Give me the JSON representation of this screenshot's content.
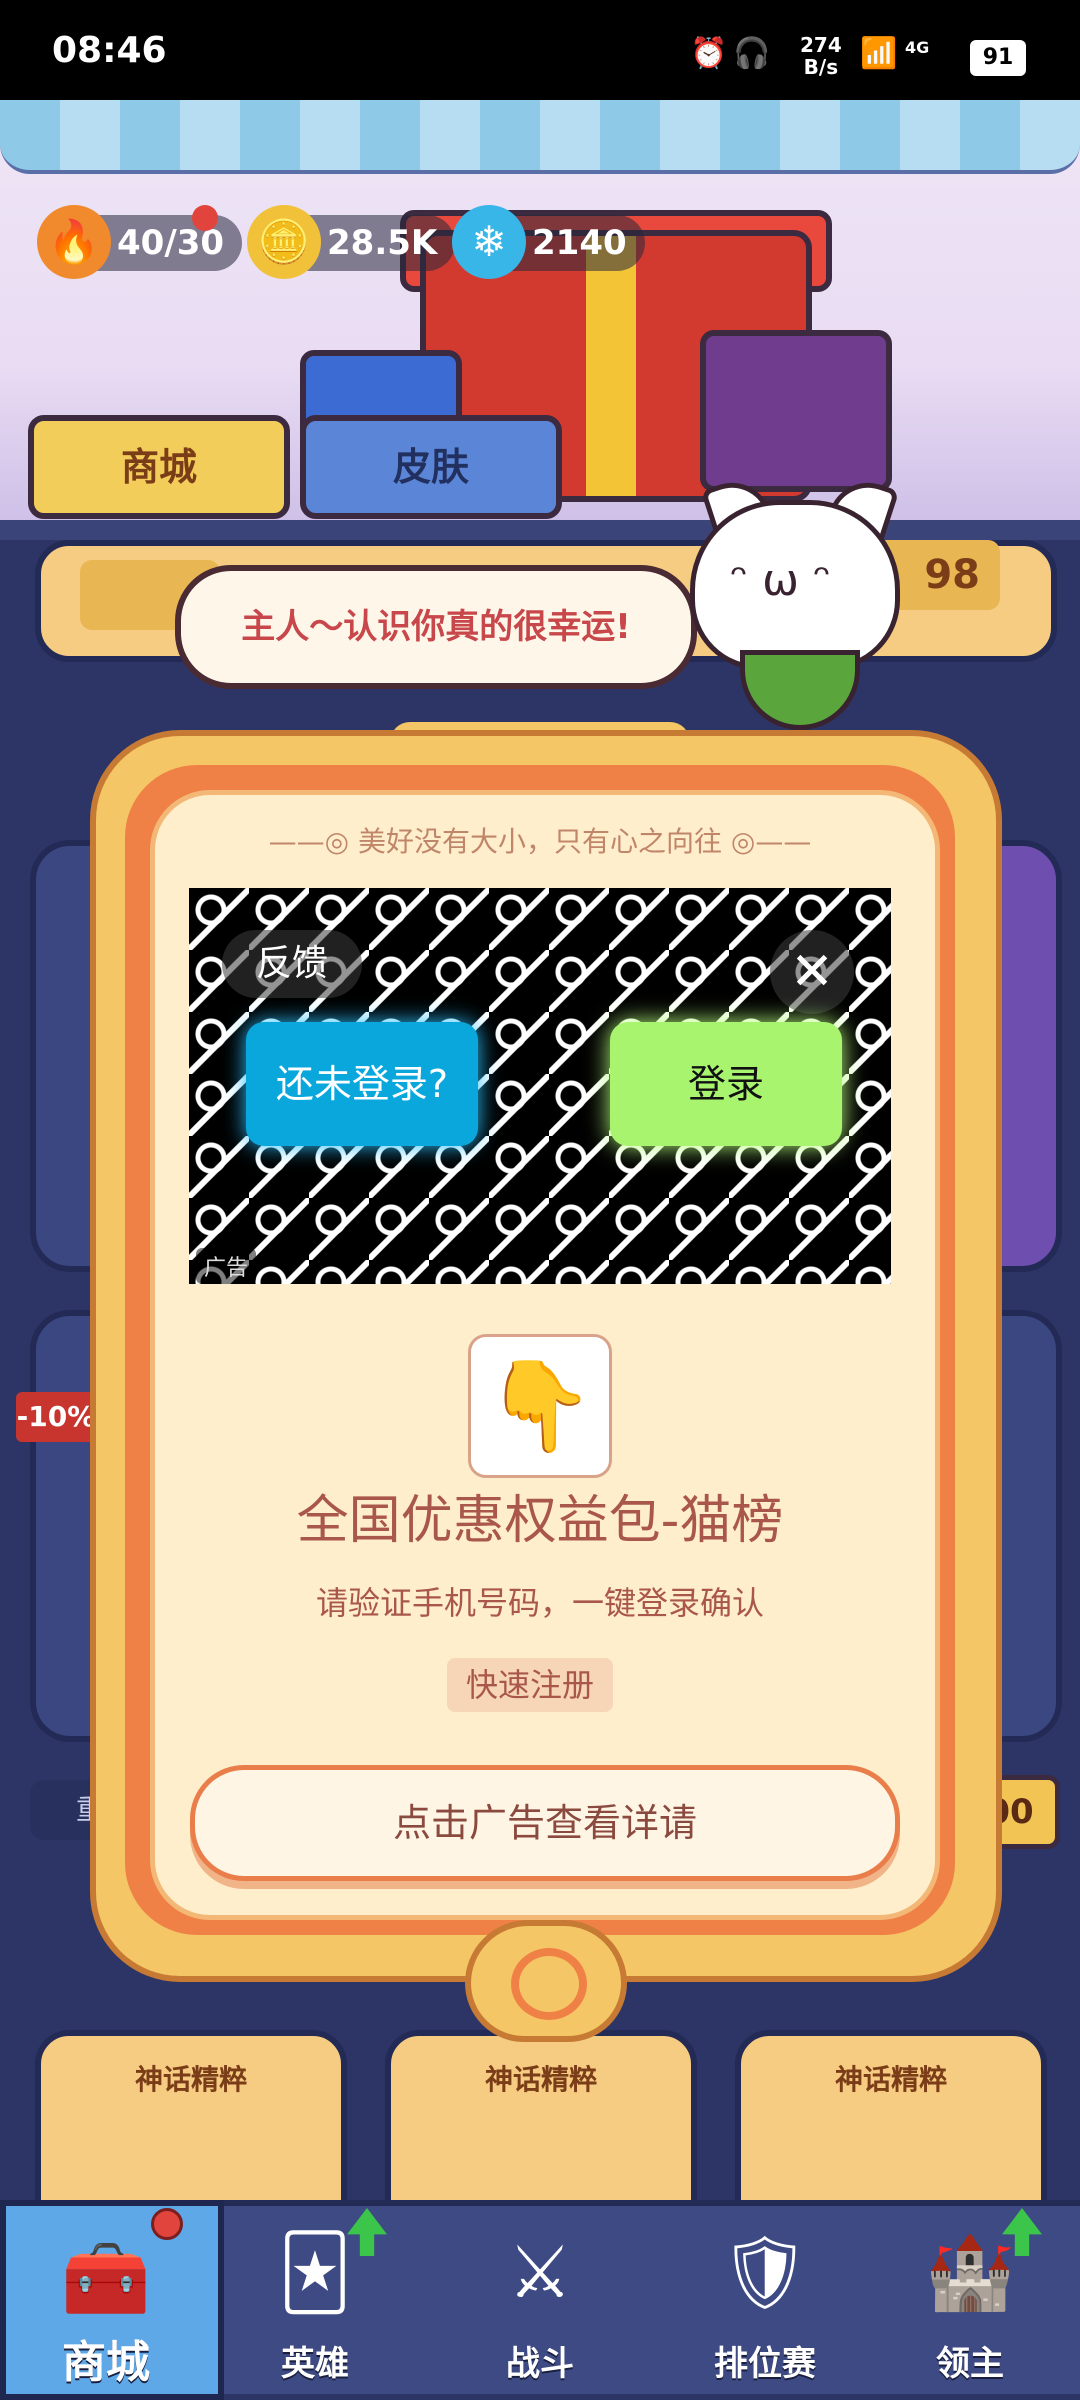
{
  "status_bar": {
    "time": "08:46",
    "net_speed": "274",
    "net_unit": "B/s",
    "network": "4G",
    "battery": "91"
  },
  "resources": {
    "energy": "40/30",
    "coins": "28.5K",
    "gems": "2140"
  },
  "top_tabs": {
    "shop": "商城",
    "skin": "皮肤"
  },
  "cat_speech": "主人～认识你真的很幸运!",
  "modal": {
    "slogan": "美好没有大小，只有心之向往",
    "ad": {
      "feedback_label": "反馈",
      "close_label": "✕",
      "prelogin_label": "还未登录?",
      "login_label": "登录",
      "ad_tag": "广告"
    },
    "app_title": "全国优惠权益包-猫榜",
    "app_subtitle": "请验证手机号码，一键登录确认",
    "register_label": "快速注册",
    "detail_button": "点击广告查看详请"
  },
  "background": {
    "discount_badge": "-10%",
    "right_price_fragment": "00",
    "left_label_fragment": "重",
    "top_price_fragment": "98",
    "card_labels": [
      "神话精粹",
      "神话精粹",
      "神话精粹"
    ]
  },
  "bottom_nav": [
    {
      "label": "商城",
      "icon": "chest-icon"
    },
    {
      "label": "英雄",
      "icon": "hero-card-icon"
    },
    {
      "label": "战斗",
      "icon": "crossed-swords-icon"
    },
    {
      "label": "排位赛",
      "icon": "rank-shield-icon"
    },
    {
      "label": "领主",
      "icon": "castle-banner-icon"
    }
  ],
  "colors": {
    "modal_orange": "#ef8147",
    "modal_cream": "#ffeecb",
    "login_green": "#a9f46f",
    "prelogin_blue": "#0aa7dc",
    "title_text": "#a9574a"
  }
}
